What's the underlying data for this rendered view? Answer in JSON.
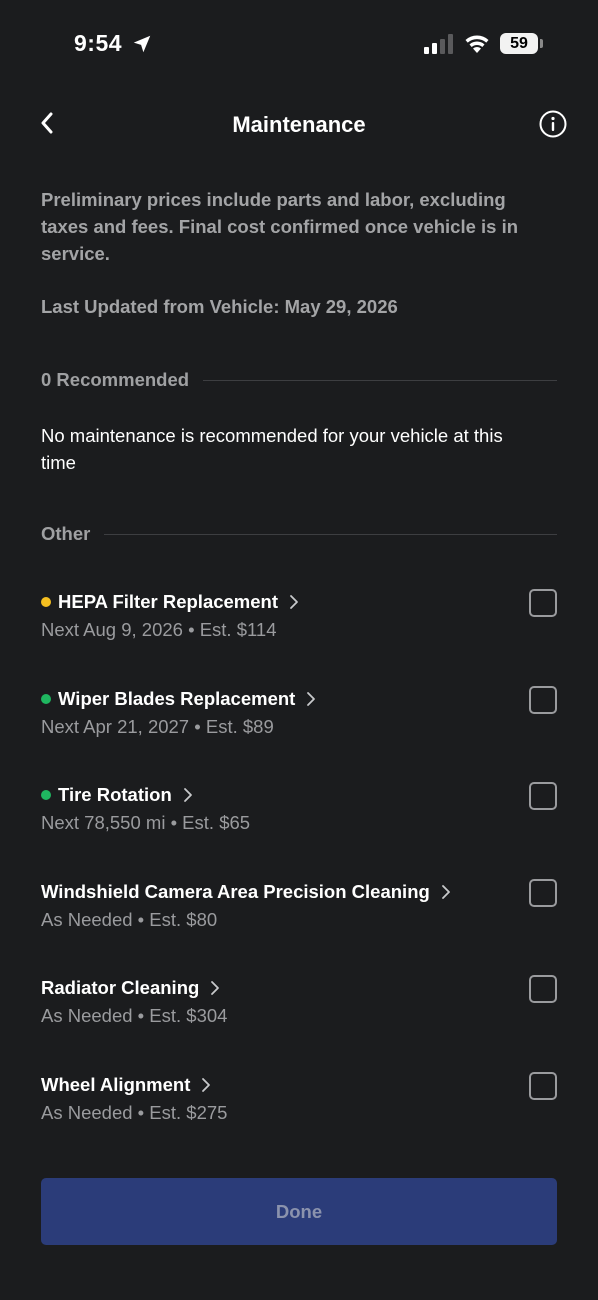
{
  "status": {
    "time": "9:54",
    "battery": "59"
  },
  "header": {
    "title": "Maintenance"
  },
  "intro": "Preliminary prices include parts and labor, excluding taxes and fees. Final cost confirmed once vehicle is in service.",
  "last_updated": "Last Updated from Vehicle: May 29, 2026",
  "recommended": {
    "label": "0 Recommended",
    "empty_message": "No maintenance is recommended for your vehicle at this time"
  },
  "other": {
    "label": "Other",
    "items": [
      {
        "title": "HEPA Filter Replacement",
        "subtitle": "Next Aug 9, 2026 • Est. $114",
        "status_color": "#f5bf20",
        "checked": false
      },
      {
        "title": "Wiper Blades Replacement",
        "subtitle": "Next Apr 21, 2027 • Est. $89",
        "status_color": "#1fb760",
        "checked": false
      },
      {
        "title": "Tire Rotation",
        "subtitle": "Next 78,550 mi • Est. $65",
        "status_color": "#1fb760",
        "checked": false
      },
      {
        "title": "Windshield Camera Area Precision Cleaning",
        "subtitle": "As Needed • Est. $80",
        "status_color": null,
        "checked": false
      },
      {
        "title": "Radiator Cleaning",
        "subtitle": "As Needed • Est. $304",
        "status_color": null,
        "checked": false
      },
      {
        "title": "Wheel Alignment",
        "subtitle": "As Needed • Est. $275",
        "status_color": null,
        "checked": false
      }
    ]
  },
  "done_label": "Done",
  "colors": {
    "background": "#1b1c1e",
    "warning_dot": "#f5bf20",
    "ok_dot": "#1fb760",
    "done_button_bg": "#2b3c79"
  },
  "icons": {
    "back": "chevron-left-icon",
    "info": "info-circle-icon",
    "location": "location-arrow-icon",
    "item_chevron": "chevron-right-icon"
  }
}
